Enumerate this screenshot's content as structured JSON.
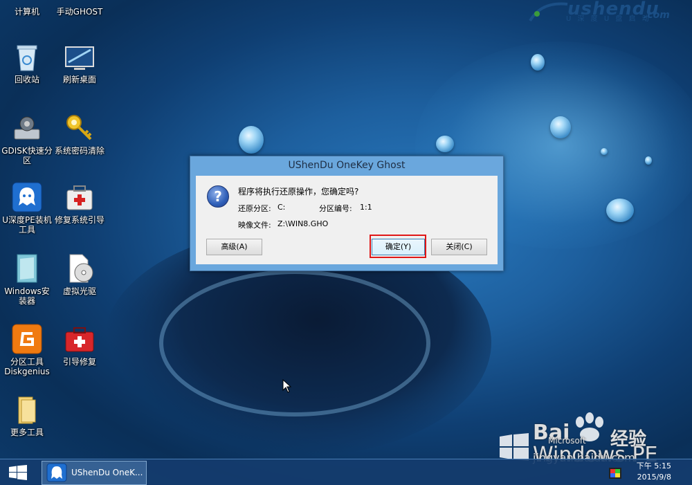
{
  "brand": {
    "logo": "ushendu",
    "subtitle": "U 深 度 U 盘 启 动",
    "domain": ".com"
  },
  "desktop_icons": [
    {
      "label": "计算机",
      "icon": "computer-icon"
    },
    {
      "label": "手动GHOST",
      "icon": "ghost-icon"
    },
    {
      "label": "回收站",
      "icon": "recycle-bin-icon"
    },
    {
      "label": "刷新桌面",
      "icon": "refresh-desktop-icon"
    },
    {
      "label": "GDISK快速分区",
      "icon": "gdisk-icon"
    },
    {
      "label": "系统密码清除",
      "icon": "key-icon"
    },
    {
      "label": "U深度PE装机工具",
      "icon": "ushendu-pe-icon"
    },
    {
      "label": "修复系统引导",
      "icon": "repair-kit-icon"
    },
    {
      "label": "Windows安装器",
      "icon": "windows-installer-icon"
    },
    {
      "label": "虚拟光驱",
      "icon": "virtual-drive-icon"
    },
    {
      "label": "分区工具Diskgenius",
      "icon": "diskgenius-icon"
    },
    {
      "label": "引导修复",
      "icon": "boot-repair-icon"
    },
    {
      "label": "更多工具",
      "icon": "folder-icon"
    }
  ],
  "dialog": {
    "title": "UShenDu OneKey Ghost",
    "question": "程序将执行还原操作，您确定吗?",
    "restore_partition_label": "还原分区:",
    "restore_partition_value": "C:",
    "partition_number_label": "分区编号:",
    "partition_number_value": "1:1",
    "image_file_label": "映像文件:",
    "image_file_value": "Z:\\WIN8.GHO",
    "buttons": {
      "advanced": "高级(A)",
      "ok": "确定(Y)",
      "close": "关闭(C)"
    }
  },
  "watermark": {
    "baidu": "Bai",
    "jingyan": "经验",
    "url": "jingyan.baidu.com",
    "microsoft": "Microsoft",
    "windows_pe": "Windows PE"
  },
  "taskbar": {
    "task_label": "UShenDu OneK...",
    "time": "下午 5:15",
    "date": "2015/9/8"
  }
}
